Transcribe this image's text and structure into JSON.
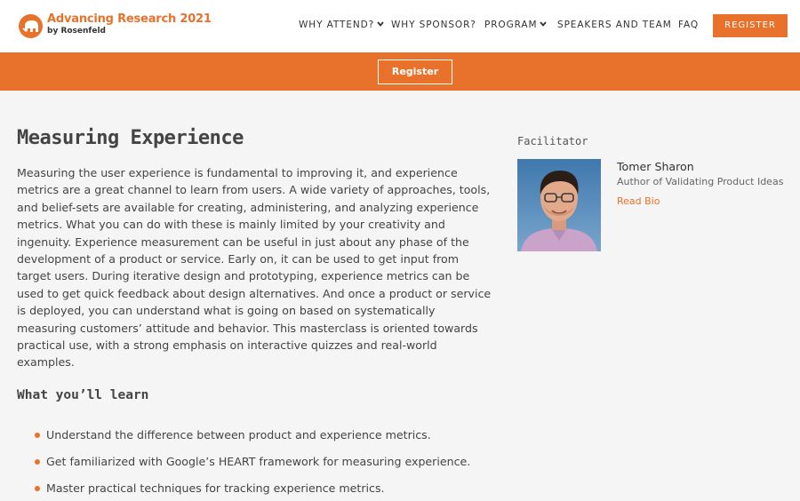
{
  "brand": {
    "title": "Advancing Research 2021",
    "subtitle": "by Rosenfeld",
    "accent_color": "#e8722c",
    "logo_icon": "elephant-icon"
  },
  "nav": {
    "items": [
      {
        "label": "WHY ATTEND?",
        "has_dropdown": true
      },
      {
        "label": "WHY SPONSOR?",
        "has_dropdown": false
      },
      {
        "label": "PROGRAM",
        "has_dropdown": true
      },
      {
        "label": "SPEAKERS AND TEAM",
        "has_dropdown": false
      },
      {
        "label": "FAQ",
        "has_dropdown": false
      }
    ],
    "register_label": "REGISTER"
  },
  "band": {
    "register_label": "Register",
    "background_color": "#e8722c"
  },
  "main": {
    "title": "Measuring Experience",
    "description": "Measuring the user experience is fundamental to improving it, and experience metrics are a great channel to learn from users. A wide variety of approaches, tools, and belief-sets are available for creating, administering, and analyzing experience metrics. What you can do with these is mainly limited by your creativity and ingenuity. Experience measurement can be useful in just about any phase of the development of a product or service. Early on, it can be used to get input from target users. During iterative design and prototyping, experience metrics can be used to get quick feedback about design alternatives. And once a product or service is deployed, you can understand what is going on based on systematically measuring customers’ attitude and behavior. This masterclass is oriented towards practical use, with a strong emphasis on interactive quizzes and real-world examples.",
    "learn_heading": "What you’ll learn",
    "learn_items": [
      "Understand the difference between product and experience metrics.",
      "Get familiarized with Google’s HEART framework for measuring experience.",
      "Master practical techniques for tracking experience metrics."
    ]
  },
  "sidebar": {
    "label": "Facilitator",
    "name": "Tomer Sharon",
    "role": "Author of Validating Product Ideas",
    "read_bio_label": "Read Bio"
  }
}
